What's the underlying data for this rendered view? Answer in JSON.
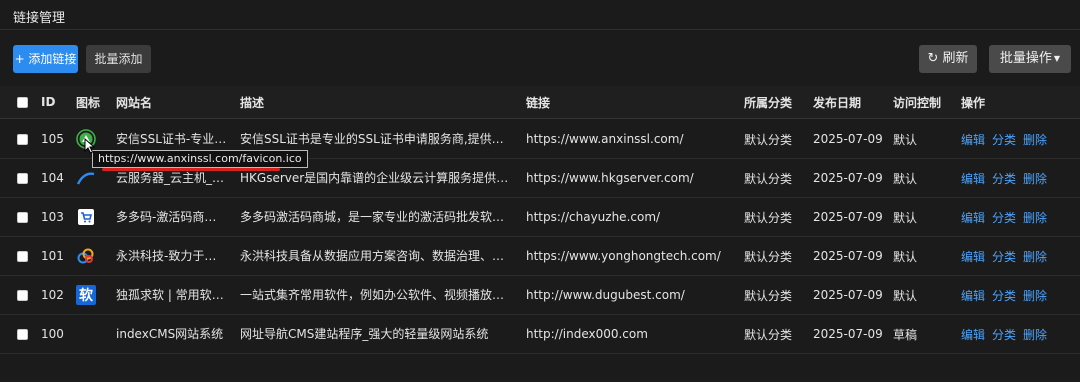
{
  "page": {
    "title": "链接管理"
  },
  "toolbar": {
    "add_label": "+ 添加链接",
    "batch_add_label": "批量添加",
    "refresh_label": "刷新",
    "batch_op_label": "批量操作"
  },
  "table": {
    "headers": {
      "id": "ID",
      "icon": "图标",
      "name": "网站名",
      "desc": "描述",
      "link": "链接",
      "category": "所属分类",
      "date": "发布日期",
      "access": "访问控制",
      "ops": "操作"
    },
    "ops": {
      "edit": "编辑",
      "category": "分类",
      "delete": "删除"
    },
    "rows": [
      {
        "id": "105",
        "icon": "anxinssl-icon",
        "name": "安信SSL证书-专业S…",
        "desc": "安信SSL证书是专业的SSL证书申请服务商,提供DigiC…",
        "link": "https://www.anxinssl.com/",
        "category": "默认分类",
        "date": "2025-07-09",
        "access": "默认"
      },
      {
        "id": "104",
        "icon": "hkgserver-icon",
        "name": "云服务器_云主机_弹…",
        "desc": "HKGserver是国内靠谱的企业级云计算服务提供商。…",
        "link": "https://www.hkgserver.com/",
        "category": "默认分类",
        "date": "2025-07-09",
        "access": "默认"
      },
      {
        "id": "103",
        "icon": "cart-icon",
        "name": "多多码-激活码商城-…",
        "desc": "多多码激活码商城，是一家专业的激活码批发软件商…",
        "link": "https://chayuzhe.com/",
        "category": "默认分类",
        "date": "2025-07-09",
        "access": "默认"
      },
      {
        "id": "101",
        "icon": "yonghong-icon",
        "name": "永洪科技-致力于打…",
        "desc": "永洪科技具备从数据应用方案咨询、数据治理、数据…",
        "link": "https://www.yonghongtech.com/",
        "category": "默认分类",
        "date": "2025-07-09",
        "access": "默认"
      },
      {
        "id": "102",
        "icon": "dugubest-icon",
        "name": "独孤求软 | 常用软件…",
        "desc": "一站式集齐常用软件，例如办公软件、视频播放、安…",
        "link": "http://www.dugubest.com/",
        "category": "默认分类",
        "date": "2025-07-09",
        "access": "默认"
      },
      {
        "id": "100",
        "icon": "",
        "name": "indexCMS网站系统",
        "desc": "网址导航CMS建站程序_强大的轻量级网站系统",
        "link": "http://index000.com",
        "category": "默认分类",
        "date": "2025-07-09",
        "access": "草稿"
      }
    ]
  },
  "tooltip": {
    "text": "https://www.anxinssl.com/favicon.ico"
  },
  "icons": {
    "dugubest_glyph": "软"
  },
  "colors": {
    "primary": "#2d8cf0",
    "link": "#4aa3ff",
    "background": "#1b1b1b",
    "highlight": "#d9211e"
  }
}
